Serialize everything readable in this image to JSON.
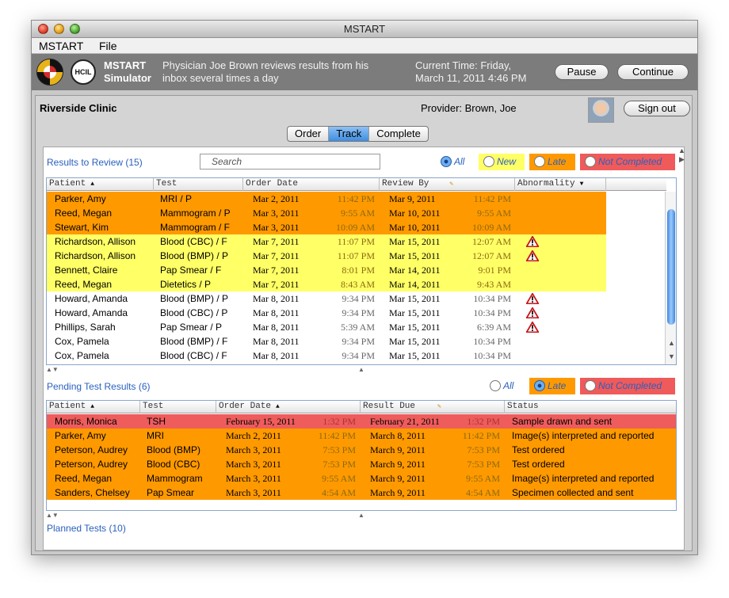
{
  "window": {
    "title": "MSTART"
  },
  "menu": {
    "items": [
      "MSTART",
      "File"
    ]
  },
  "header": {
    "app_line1": "MSTART",
    "app_line2": "Simulator",
    "desc_line1": "Physician Joe Brown reviews results from his",
    "desc_line2": "inbox several times a day",
    "time_line1": "Current Time: Friday,",
    "time_line2": "March 11, 2011 4:46 PM",
    "pause_label": "Pause",
    "continue_label": "Continue",
    "hcil_text": "HCIL"
  },
  "clinic": {
    "name": "Riverside Clinic",
    "provider": "Provider: Brown, Joe",
    "signout_label": "Sign out"
  },
  "tabs": [
    "Order",
    "Track",
    "Complete"
  ],
  "active_tab": "Track",
  "review": {
    "label": "Results to Review (15)",
    "search_placeholder": "Search",
    "filters": [
      "All",
      "New",
      "Late",
      "Not Completed"
    ],
    "selected_filter": "All",
    "columns": [
      "Patient",
      "Test",
      "Order Date",
      "Review By",
      "Abnormality"
    ],
    "rows": [
      {
        "patient": "Parker, Amy",
        "test": "MRI / P",
        "order_date": "Mar 2, 2011",
        "order_time": "11:42 PM",
        "review_date": "Mar 9, 2011",
        "review_time": "11:42 PM",
        "abnormal": false,
        "status": "late"
      },
      {
        "patient": "Reed, Megan",
        "test": "Mammogram / P",
        "order_date": "Mar 3, 2011",
        "order_time": "9:55 AM",
        "review_date": "Mar 10, 2011",
        "review_time": "9:55 AM",
        "abnormal": false,
        "status": "late"
      },
      {
        "patient": "Stewart, Kim",
        "test": "Mammogram / F",
        "order_date": "Mar 3, 2011",
        "order_time": "10:09 AM",
        "review_date": "Mar 10, 2011",
        "review_time": "10:09 AM",
        "abnormal": false,
        "status": "late"
      },
      {
        "patient": "Richardson, Allison",
        "test": "Blood (CBC) / F",
        "order_date": "Mar 7, 2011",
        "order_time": "11:07 PM",
        "review_date": "Mar 15, 2011",
        "review_time": "12:07 AM",
        "abnormal": true,
        "status": "new"
      },
      {
        "patient": "Richardson, Allison",
        "test": "Blood (BMP) / P",
        "order_date": "Mar 7, 2011",
        "order_time": "11:07 PM",
        "review_date": "Mar 15, 2011",
        "review_time": "12:07 AM",
        "abnormal": true,
        "status": "new"
      },
      {
        "patient": "Bennett, Claire",
        "test": "Pap Smear / F",
        "order_date": "Mar 7, 2011",
        "order_time": "8:01 PM",
        "review_date": "Mar 14, 2011",
        "review_time": "9:01 PM",
        "abnormal": false,
        "status": "new"
      },
      {
        "patient": "Reed, Megan",
        "test": "Dietetics / P",
        "order_date": "Mar 7, 2011",
        "order_time": "8:43 AM",
        "review_date": "Mar 14, 2011",
        "review_time": "9:43 AM",
        "abnormal": false,
        "status": "new"
      },
      {
        "patient": "Howard, Amanda",
        "test": "Blood (BMP) / P",
        "order_date": "Mar 8, 2011",
        "order_time": "9:34 PM",
        "review_date": "Mar 15, 2011",
        "review_time": "10:34 PM",
        "abnormal": true,
        "status": "plain"
      },
      {
        "patient": "Howard, Amanda",
        "test": "Blood (CBC) / P",
        "order_date": "Mar 8, 2011",
        "order_time": "9:34 PM",
        "review_date": "Mar 15, 2011",
        "review_time": "10:34 PM",
        "abnormal": true,
        "status": "plain"
      },
      {
        "patient": "Phillips, Sarah",
        "test": "Pap Smear / P",
        "order_date": "Mar 8, 2011",
        "order_time": "5:39 AM",
        "review_date": "Mar 15, 2011",
        "review_time": "6:39 AM",
        "abnormal": true,
        "status": "plain"
      },
      {
        "patient": "Cox, Pamela",
        "test": "Blood (BMP) / F",
        "order_date": "Mar 8, 2011",
        "order_time": "9:34 PM",
        "review_date": "Mar 15, 2011",
        "review_time": "10:34 PM",
        "abnormal": false,
        "status": "plain"
      },
      {
        "patient": "Cox, Pamela",
        "test": "Blood (CBC) / F",
        "order_date": "Mar 8, 2011",
        "order_time": "9:34 PM",
        "review_date": "Mar 15, 2011",
        "review_time": "10:34 PM",
        "abnormal": false,
        "status": "plain"
      }
    ]
  },
  "pending": {
    "label": "Pending Test Results (6)",
    "filters": [
      "All",
      "Late",
      "Not Completed"
    ],
    "selected_filter": "Late",
    "columns": [
      "Patient",
      "Test",
      "Order Date",
      "Result Due",
      "Status"
    ],
    "rows": [
      {
        "patient": "Morris, Monica",
        "test": "TSH",
        "order_date": "February 15, 2011",
        "order_time": "1:32 PM",
        "due_date": "February 21, 2011",
        "due_time": "1:32 PM",
        "status_text": "Sample drawn and sent",
        "status": "nc"
      },
      {
        "patient": "Parker, Amy",
        "test": "MRI",
        "order_date": "March 2, 2011",
        "order_time": "11:42 PM",
        "due_date": "March 8, 2011",
        "due_time": "11:42 PM",
        "status_text": "Image(s) interpreted and reported",
        "status": "late"
      },
      {
        "patient": "Peterson, Audrey",
        "test": "Blood (BMP)",
        "order_date": "March 3, 2011",
        "order_time": "7:53 PM",
        "due_date": "March 9, 2011",
        "due_time": "7:53 PM",
        "status_text": "Test ordered",
        "status": "late"
      },
      {
        "patient": "Peterson, Audrey",
        "test": "Blood (CBC)",
        "order_date": "March 3, 2011",
        "order_time": "7:53 PM",
        "due_date": "March 9, 2011",
        "due_time": "7:53 PM",
        "status_text": "Test ordered",
        "status": "late"
      },
      {
        "patient": "Reed, Megan",
        "test": "Mammogram",
        "order_date": "March 3, 2011",
        "order_time": "9:55 AM",
        "due_date": "March 9, 2011",
        "due_time": "9:55 AM",
        "status_text": "Image(s) interpreted and reported",
        "status": "late"
      },
      {
        "patient": "Sanders, Chelsey",
        "test": "Pap Smear",
        "order_date": "March 3, 2011",
        "order_time": "4:54 AM",
        "due_date": "March 9, 2011",
        "due_time": "4:54 AM",
        "status_text": "Specimen collected and sent",
        "status": "late"
      }
    ]
  },
  "planned": {
    "label": "Planned Tests (10)"
  },
  "colors": {
    "late": "#ff9900",
    "new": "#ffff66",
    "not_completed": "#ee5c5c",
    "link_blue": "#2a60c0",
    "header_gray": "#7c7c7c",
    "active_tab": "#3f8ee0"
  },
  "icons": {
    "abnormal": "warning-triangle-icon",
    "sort": "sort-caret-icon",
    "edit": "pencil-icon"
  }
}
